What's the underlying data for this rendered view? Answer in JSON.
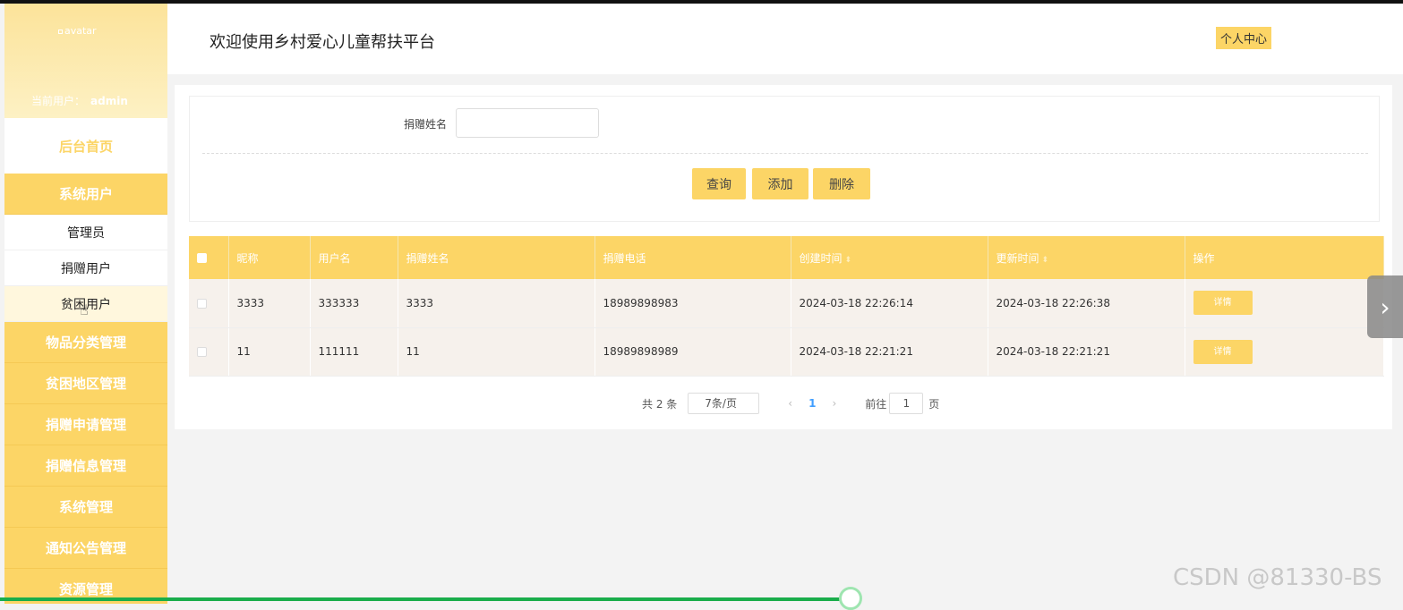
{
  "sidebar": {
    "avatar_alt": "avatar",
    "current_user_label": "当前用户：",
    "current_user": "admin",
    "home": "后台首页",
    "group_system_users": "系统用户",
    "sub_items": [
      "管理员",
      "捐赠用户",
      "贫困用户"
    ],
    "groups": [
      "物品分类管理",
      "贫困地区管理",
      "捐赠申请管理",
      "捐赠信息管理",
      "系统管理",
      "通知公告管理",
      "资源管理"
    ]
  },
  "header": {
    "title": "欢迎使用乡村爱心儿童帮扶平台",
    "profile_button": "个人中心"
  },
  "search": {
    "label": "捐赠姓名",
    "value": "",
    "query_button": "查询",
    "add_button": "添加",
    "delete_button": "删除"
  },
  "table": {
    "headers": [
      "昵称",
      "用户名",
      "捐赠姓名",
      "捐赠电话",
      "创建时间",
      "更新时间",
      "操作"
    ],
    "rows": [
      {
        "nickname": "3333",
        "username": "333333",
        "donor_name": "3333",
        "phone": "18989898983",
        "created": "2024-03-18 22:26:14",
        "updated": "2024-03-18 22:26:38",
        "action": "详情"
      },
      {
        "nickname": "11",
        "username": "111111",
        "donor_name": "11",
        "phone": "18989898989",
        "created": "2024-03-18 22:21:21",
        "updated": "2024-03-18 22:21:21",
        "action": "详情"
      }
    ]
  },
  "pager": {
    "total": "共 2 条",
    "page_size": "7条/页",
    "current_page": "1",
    "goto_label": "前往",
    "goto_value": "1",
    "page_suffix": "页"
  },
  "watermark": "CSDN @81330-BS",
  "colors": {
    "accent": "#fcd566",
    "row_bg": "#f6f1ec",
    "progress": "#1aad4b"
  },
  "video_progress_fraction": 0.6
}
